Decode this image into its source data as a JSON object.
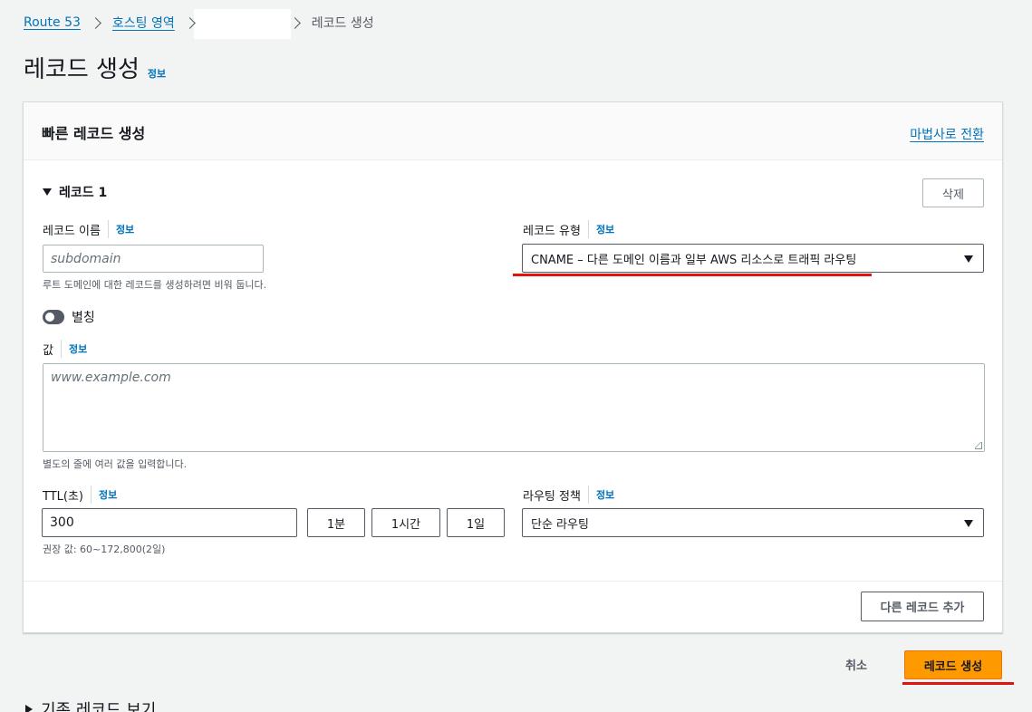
{
  "breadcrumb": {
    "route53": "Route 53",
    "hosted_zones": "호스팅 영역",
    "current": "레코드 생성"
  },
  "page": {
    "title": "레코드 생성",
    "info": "정보"
  },
  "panel": {
    "title": "빠른 레코드 생성",
    "wizard_link": "마법사로 전환",
    "record_header": "레코드 1",
    "delete_label": "삭제",
    "record_name": {
      "label": "레코드 이름",
      "info": "정보",
      "placeholder": "subdomain",
      "hint": "루트 도메인에 대한 레코드를 생성하려면 비워 둡니다."
    },
    "record_type": {
      "label": "레코드 유형",
      "info": "정보",
      "selected": "CNAME – 다른 도메인 이름과 일부 AWS 리소스로 트래픽 라우팅"
    },
    "alias": {
      "label": "별칭",
      "enabled": false
    },
    "value": {
      "label": "값",
      "info": "정보",
      "placeholder": "www.example.com",
      "hint": "별도의 줄에 여러 값을 입력합니다."
    },
    "ttl": {
      "label": "TTL(초)",
      "info": "정보",
      "value": "300",
      "presets": [
        "1분",
        "1시간",
        "1일"
      ],
      "hint": "권장 값: 60~172,800(2일)"
    },
    "routing": {
      "label": "라우팅 정책",
      "info": "정보",
      "selected": "단순 라우팅"
    },
    "add_record_label": "다른 레코드 추가"
  },
  "actions": {
    "cancel": "취소",
    "create": "레코드 생성"
  },
  "existing_records": "기존 레코드 보기",
  "colors": {
    "primary": "#ff9900",
    "link": "#0073bb",
    "annotation": "#e0140c"
  }
}
